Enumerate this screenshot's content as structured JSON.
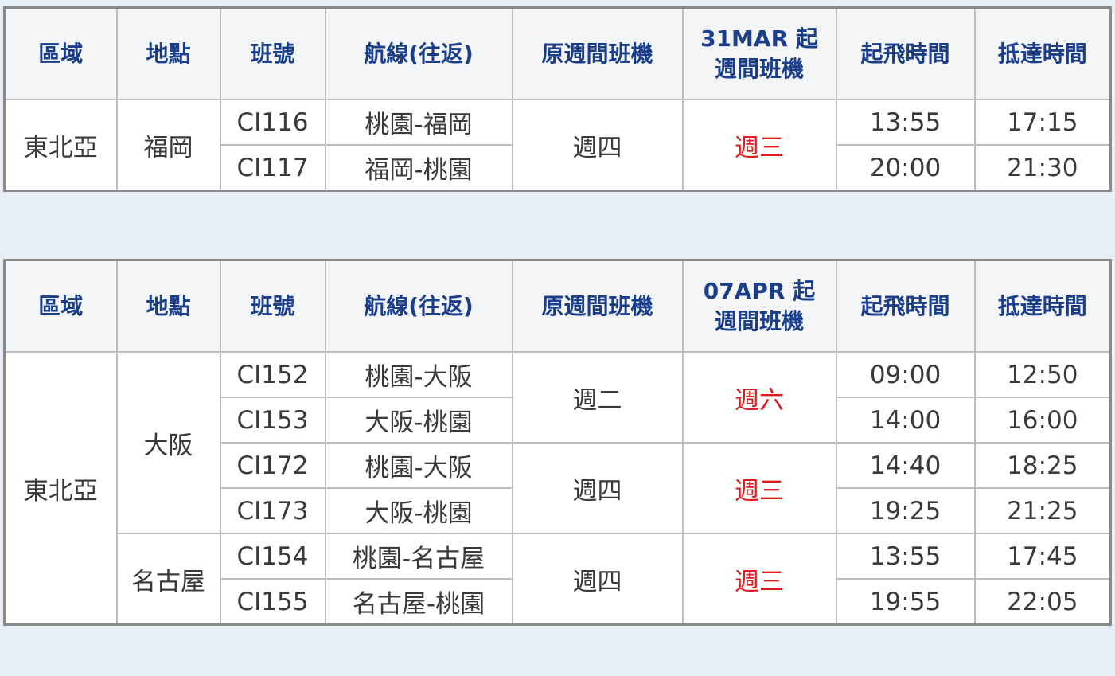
{
  "headers": {
    "region": "區域",
    "location": "地點",
    "flight_no": "班號",
    "route": "航線(往返)",
    "original_days": "原週間班機",
    "time_dep": "起飛時間",
    "time_arr": "抵達時間"
  },
  "table1": {
    "new_days_line1": "31MAR 起",
    "new_days_line2": "週間班機",
    "region": "東北亞",
    "location": "福岡",
    "original_day": "週四",
    "new_day": "週三",
    "rows": [
      {
        "flight": "CI116",
        "route": "桃園-福岡",
        "dep": "13:55",
        "arr": "17:15"
      },
      {
        "flight": "CI117",
        "route": "福岡-桃園",
        "dep": "20:00",
        "arr": "21:30"
      }
    ]
  },
  "table2": {
    "new_days_line1": "07APR 起",
    "new_days_line2": "週間班機",
    "region": "東北亞",
    "locations": [
      "大阪",
      "名古屋"
    ],
    "groups": [
      {
        "original_day": "週二",
        "new_day": "週六"
      },
      {
        "original_day": "週四",
        "new_day": "週三"
      },
      {
        "original_day": "週四",
        "new_day": "週三"
      }
    ],
    "rows": [
      {
        "flight": "CI152",
        "route": "桃園-大阪",
        "dep": "09:00",
        "arr": "12:50"
      },
      {
        "flight": "CI153",
        "route": "大阪-桃園",
        "dep": "14:00",
        "arr": "16:00"
      },
      {
        "flight": "CI172",
        "route": "桃園-大阪",
        "dep": "14:40",
        "arr": "18:25"
      },
      {
        "flight": "CI173",
        "route": "大阪-桃園",
        "dep": "19:25",
        "arr": "21:25"
      },
      {
        "flight": "CI154",
        "route": "桃園-名古屋",
        "dep": "13:55",
        "arr": "17:45"
      },
      {
        "flight": "CI155",
        "route": "名古屋-桃園",
        "dep": "19:55",
        "arr": "22:05"
      }
    ]
  },
  "colors": {
    "header_text": "#1b3e8a",
    "highlight_red": "#e01b1b",
    "body_text": "#3a3a3a",
    "page_background": "#e8eef6"
  }
}
